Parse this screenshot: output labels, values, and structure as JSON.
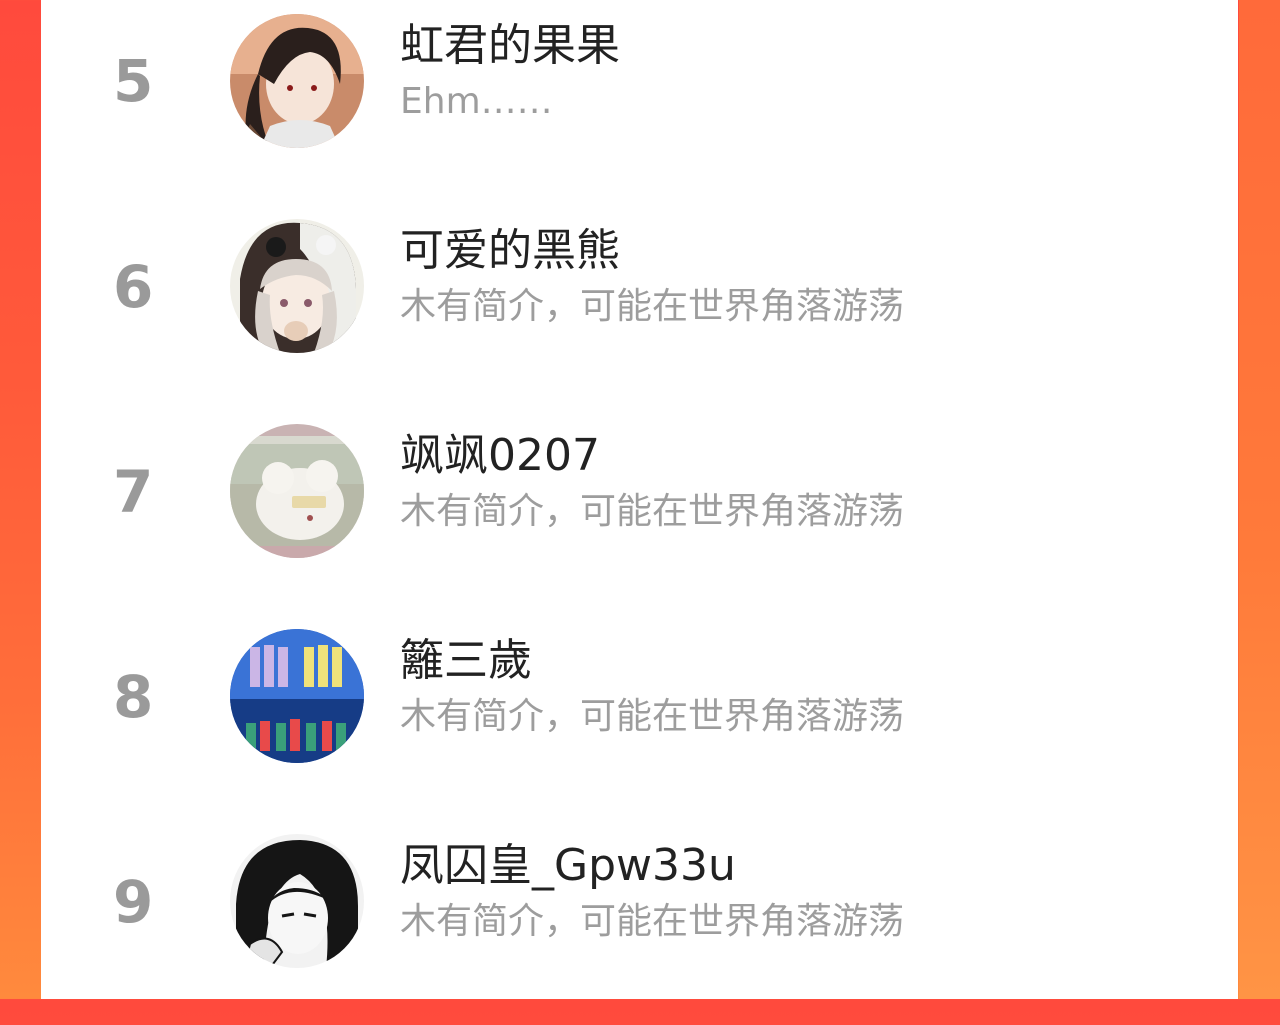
{
  "ranking": {
    "items": [
      {
        "rank": "5",
        "name": "虹君的果果",
        "bio": "Ehm……",
        "avatar_icon": "anime-portrait-avatar"
      },
      {
        "rank": "6",
        "name": "可爱的黑熊",
        "bio": "木有简介，可能在世界角落游荡",
        "avatar_icon": "bear-hood-girl-avatar"
      },
      {
        "rank": "7",
        "name": "飒飒0207",
        "bio": "木有简介，可能在世界角落游荡",
        "avatar_icon": "plush-toy-avatar"
      },
      {
        "rank": "8",
        "name": "籬三歲",
        "bio": "木有简介，可能在世界角落游荡",
        "avatar_icon": "stage-group-avatar"
      },
      {
        "rank": "9",
        "name": "凤囚皇_Gpw33u",
        "bio": "木有简介，可能在世界角落游荡",
        "avatar_icon": "manga-sketch-avatar"
      }
    ]
  },
  "colors": {
    "background_left": "#ff4a3d",
    "background_right": "#ff8a3d",
    "panel": "#ffffff",
    "rank_text": "#9a9a9a",
    "name_text": "#222222",
    "bio_text": "#9d9d9d"
  }
}
